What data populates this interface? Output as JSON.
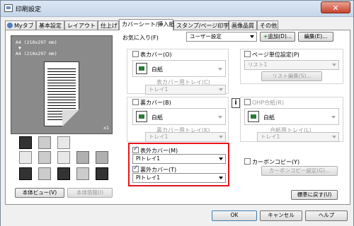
{
  "window": {
    "title": "印刷設定",
    "close_glyph": "✕"
  },
  "tabs": [
    "Myタブ",
    "基本設定",
    "レイアウト",
    "仕上げ",
    "カバーシート/挿入紙",
    "スタンプ/ページ印字",
    "画像品質",
    "その他"
  ],
  "preview": {
    "line1": "A4 (210x297 mm)",
    "arrow": "▼",
    "line2": "A4 (210x297 mm)",
    "count": "x1"
  },
  "left_buttons": {
    "view": "本体ビュー(V)",
    "info": "本体情報(I)"
  },
  "favorites": {
    "label": "お気に入り(F)",
    "value": "ユーザー設定",
    "add": "追加(D)...",
    "edit": "編集(E)..."
  },
  "front_cover": {
    "label": "表カバー(O)",
    "checked": false,
    "paper": "白紙",
    "tray_label": "表カバー用トレイ(C)",
    "tray": "トレイ1"
  },
  "back_cover": {
    "label": "裏カバー(B)",
    "checked": false,
    "paper": "白紙",
    "tray_label": "裏カバー用トレイ(K)",
    "tray": "トレイ1"
  },
  "front_outer": {
    "label": "表外カバー(M)",
    "checked": true,
    "tray": "PIトレイ1"
  },
  "back_outer": {
    "label": "裏外カバー(T)",
    "checked": true,
    "tray": "PIトレイ1"
  },
  "page_setting": {
    "label": "ページ単位設定(P)",
    "checked": false,
    "list": "リスト1",
    "list_edit": "リスト編集(S)..."
  },
  "ohp": {
    "info": "i",
    "label": "OHP合紙(R)",
    "checked": false,
    "paper": "白紙",
    "tray_label": "合紙用トレイ(L)",
    "tray": "トレイ1"
  },
  "carbon": {
    "label": "カーボンコピー(Y)",
    "checked": false,
    "settings": "カーボンコピー設定(G)..."
  },
  "defaults_button": "標準に戻す(U)",
  "footer": {
    "ok": "OK",
    "cancel": "キャンセル",
    "help": "ヘルプ"
  },
  "colors": {
    "highlight": "#e8141c"
  }
}
